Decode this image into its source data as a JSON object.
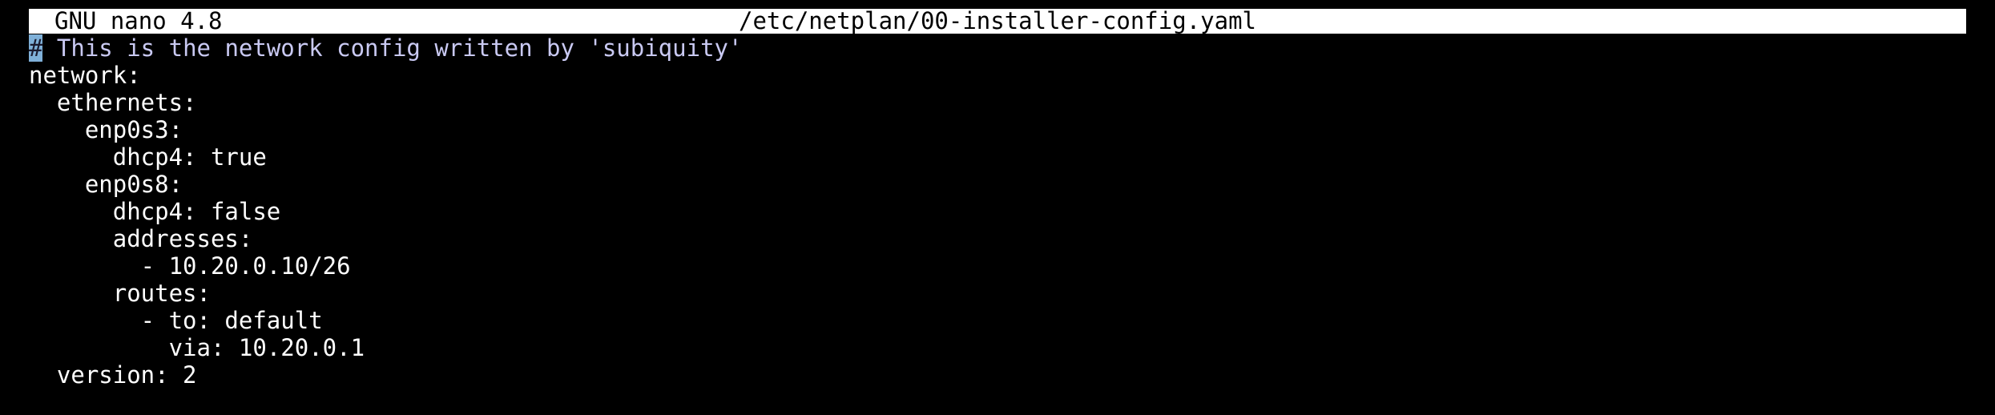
{
  "titlebar": {
    "app_name": "GNU nano 4.8",
    "file_name": "/etc/netplan/00-installer-config.yaml"
  },
  "editor": {
    "cursor_char": "#",
    "comment_text": " This is the network config written by 'subiquity'",
    "lines": [
      "network:",
      "  ethernets:",
      "    enp0s3:",
      "      dhcp4: true",
      "    enp0s8:",
      "      dhcp4: false",
      "      addresses:",
      "        - 10.20.0.10/26",
      "      routes:",
      "        - to: default",
      "          via: 10.20.0.1",
      "  version: 2"
    ]
  },
  "colors": {
    "background": "#000000",
    "text": "#ffffff",
    "titlebar_bg": "#ffffff",
    "comment": "#c9c9f2",
    "cursor": "#7fb0d8"
  }
}
